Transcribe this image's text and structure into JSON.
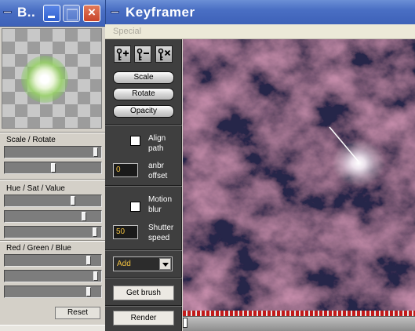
{
  "brush_window": {
    "title": "B..",
    "buttons": {
      "minimize": "minimize-icon",
      "maximize": "maximize-icon",
      "close": "×"
    },
    "sections": {
      "scale_rotate": "Scale / Rotate",
      "hue_sat_value": "Hue / Sat / Value",
      "red_green_blue": "Red / Green / Blue"
    },
    "slider_levels": {
      "scale": 0.97,
      "rotate": 0.5,
      "hue": 0.72,
      "sat": 0.84,
      "value": 0.96,
      "red": 0.89,
      "green": 0.97,
      "blue": 0.89
    },
    "reset_label": "Reset"
  },
  "keyframer": {
    "title": "Keyframer",
    "menu": {
      "special": "Special"
    },
    "keyframe_buttons": {
      "add": "key-add-icon",
      "remove": "key-remove-icon",
      "clear": "key-clear-icon"
    },
    "modes": {
      "scale": "Scale",
      "rotate": "Rotate",
      "opacity": "Opacity"
    },
    "align_path": {
      "label_line1": "Align",
      "label_line2": "path",
      "checked": false
    },
    "offset": {
      "value": "0",
      "label_line1": "anbr",
      "label_line2": "offset"
    },
    "motion_blur": {
      "label_line1": "Motion",
      "label_line2": "blur",
      "checked": false
    },
    "shutter": {
      "value": "50",
      "label_line1": "Shutter",
      "label_line2": "speed"
    },
    "blend_mode": {
      "selected": "Add"
    },
    "get_brush_label": "Get brush",
    "render_label": "Render",
    "timeline_position": 0.0
  },
  "colors": {
    "titlebar": "#3d61b8",
    "tool_panel": "#3f3f3f",
    "field_text": "#f0c040",
    "timeline_ticks": "#c21a1a"
  }
}
